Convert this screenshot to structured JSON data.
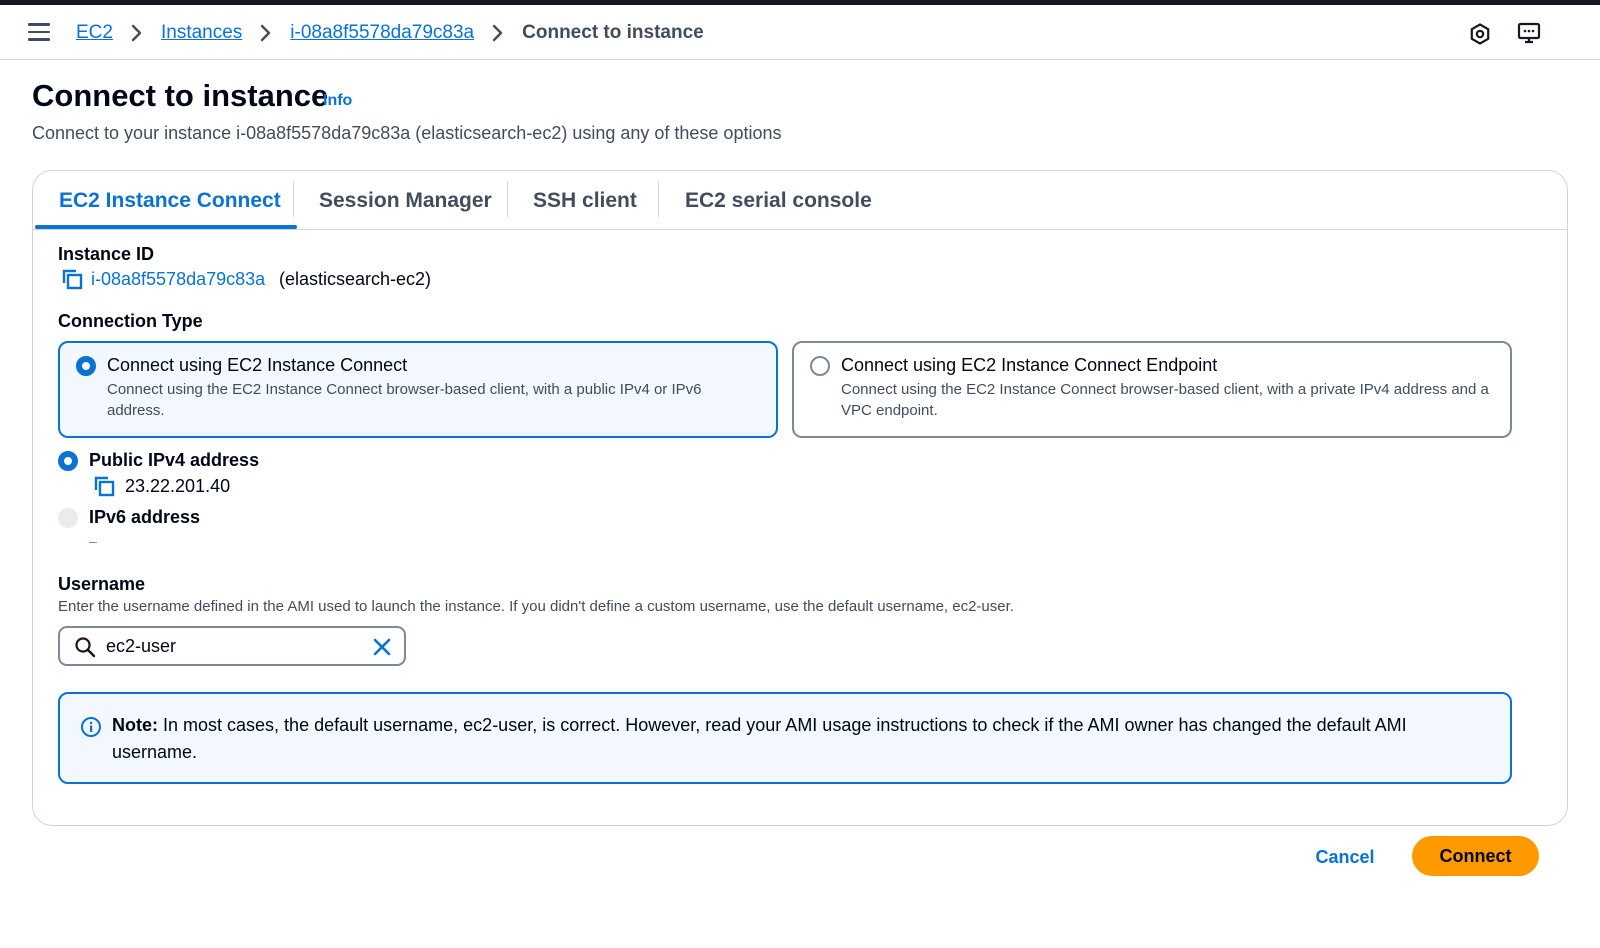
{
  "breadcrumb": {
    "items": [
      "EC2",
      "Instances",
      "i-08a8f5578da79c83a"
    ],
    "current": "Connect to instance"
  },
  "header": {
    "icons": [
      "hamburger-menu-icon",
      "settings-hex-icon",
      "feedback-screen-icon"
    ]
  },
  "page": {
    "title": "Connect to instance",
    "info_label": "Info",
    "description": "Connect to your instance i-08a8f5578da79c83a (elasticsearch-ec2) using any of these options"
  },
  "tabs": [
    {
      "label": "EC2 Instance Connect",
      "active": true
    },
    {
      "label": "Session Manager",
      "active": false
    },
    {
      "label": "SSH client",
      "active": false
    },
    {
      "label": "EC2 serial console",
      "active": false
    }
  ],
  "instance": {
    "label": "Instance ID",
    "id": "i-08a8f5578da79c83a",
    "name": "(elasticsearch-ec2)"
  },
  "connection_type": {
    "label": "Connection Type",
    "options": [
      {
        "title": "Connect using EC2 Instance Connect",
        "description": "Connect using the EC2 Instance Connect browser-based client, with a public IPv4 or IPv6 address.",
        "selected": true
      },
      {
        "title": "Connect using EC2 Instance Connect Endpoint",
        "description": "Connect using the EC2 Instance Connect browser-based client, with a private IPv4 address and a VPC endpoint.",
        "selected": false
      }
    ]
  },
  "address": {
    "public_ipv4_label": "Public IPv4 address",
    "public_ipv4_value": "23.22.201.40",
    "ipv6_label": "IPv6 address",
    "ipv6_value": "–"
  },
  "username": {
    "label": "Username",
    "hint": "Enter the username defined in the AMI used to launch the instance. If you didn't define a custom username, use the default username, ec2-user.",
    "value": "ec2-user"
  },
  "note": {
    "prefix": "Note:",
    "text": "In most cases, the default username, ec2-user, is correct. However, read your AMI usage instructions to check if the AMI owner has changed the default AMI username."
  },
  "actions": {
    "cancel_label": "Cancel",
    "connect_label": "Connect"
  },
  "colors": {
    "accent": "#0972d3",
    "primary_button": "#ff9900",
    "border": "#d1d5db"
  }
}
